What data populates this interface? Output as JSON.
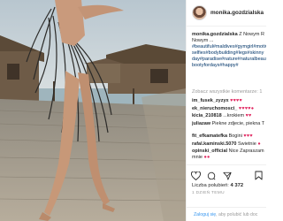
{
  "header": {
    "username": "monika.gozdzialska"
  },
  "caption": {
    "username": "monika.gozdzialska",
    "text": "Z Nowym R Nowym ... ",
    "tags": "#beautiful#maldives#gymgirl#motivation#fit#fitness#fitnessmotivation#fitness selfies#bodybuilding#legs#skinny day#paradise#nature#naturalbeauty bootyfordays#happy#"
  },
  "see_all_comments": "Zobacz wszystkie komentarze: 1",
  "comments": [
    {
      "user": "im_fusek_zyzyx",
      "text": "",
      "emoji": "♥♥♥♥"
    },
    {
      "user": "ek_nieruchomosci_",
      "text": "",
      "emoji": "♥♥♥♥●"
    },
    {
      "user": "kicia_210818",
      "text": "...krokiem",
      "emoji": "♥♥"
    },
    {
      "user": "juliazaw",
      "text": "Piekne zdjecie, piekna T"
    },
    {
      "user": "fit_efkamatefka",
      "text": "Bogini",
      "emoji": "♥♥♥"
    },
    {
      "user": "rafal.kaminski.5070",
      "text": "Swietnie",
      "emoji": "●"
    },
    {
      "user": "opinski_official",
      "text": "Nice",
      "suffix": "Zapraszam mnie",
      "emoji2": "●●"
    }
  ],
  "likes": {
    "label": "Liczba polubień:",
    "count": "4 372"
  },
  "date": "1 DZIEŃ TEMU",
  "login": {
    "link": "Zaloguj się",
    "rest": ", aby polubić lub doc"
  },
  "colors": {
    "link": "#003569",
    "login_link": "#3897f0",
    "muted": "#999999",
    "heart": "#e0245e"
  },
  "icons": {
    "like": "heart-icon",
    "comment": "comment-icon",
    "share": "share-icon",
    "save": "bookmark-icon"
  }
}
